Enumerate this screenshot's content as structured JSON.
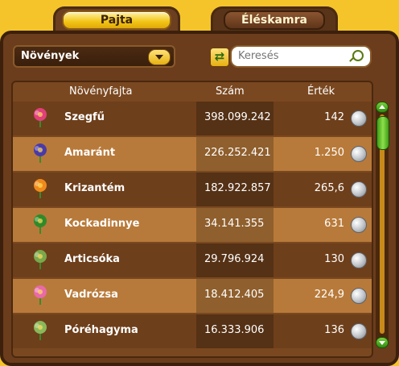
{
  "tabs": [
    {
      "label": "Pajta",
      "active": true
    },
    {
      "label": "Éléskamra",
      "active": false
    }
  ],
  "filter": {
    "selected": "Növények"
  },
  "search": {
    "placeholder": "Keresés"
  },
  "columns": {
    "name": "Növényfajta",
    "count": "Szám",
    "value": "Érték"
  },
  "rows": [
    {
      "name": "Szegfű",
      "count": "398.099.242",
      "value": "142",
      "icon": "carnation-icon",
      "color": "#e0407a"
    },
    {
      "name": "Amaránt",
      "count": "226.252.421",
      "value": "1.250",
      "icon": "amaranth-icon",
      "color": "#4a3aa8"
    },
    {
      "name": "Krizantém",
      "count": "182.922.857",
      "value": "265,6",
      "icon": "chrysanthemum-icon",
      "color": "#f08a1a"
    },
    {
      "name": "Kockadinnye",
      "count": "34.141.355",
      "value": "631",
      "icon": "square-watermelon-icon",
      "color": "#2e8a2a"
    },
    {
      "name": "Articsóka",
      "count": "29.796.924",
      "value": "130",
      "icon": "artichoke-icon",
      "color": "#7aa84a"
    },
    {
      "name": "Vadrózsa",
      "count": "18.412.405",
      "value": "224,9",
      "icon": "wild-rose-icon",
      "color": "#e86aa8"
    },
    {
      "name": "Póréhagyma",
      "count": "16.333.906",
      "value": "136",
      "icon": "leek-icon",
      "color": "#8ab85a"
    }
  ],
  "coin_icon": "silver-coin-icon"
}
